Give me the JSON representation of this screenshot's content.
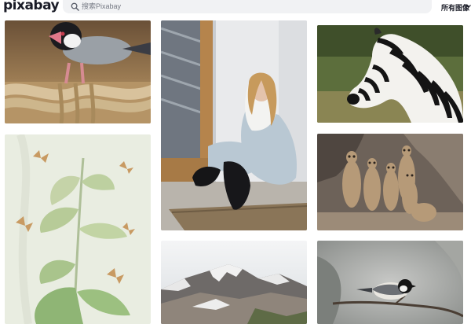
{
  "header": {
    "logo": "pixabay",
    "search_placeholder": "搜索Pixabay",
    "filter_label": "所有图像"
  },
  "icons": {
    "search": "search-icon",
    "filter_chevron": "chevron-down-icon"
  },
  "colors": {
    "header_bg": "#ffffff",
    "search_bg": "#f1f2f4",
    "text": "#191b26",
    "muted": "#767a84"
  },
  "gallery": {
    "columns": 3,
    "images": [
      {
        "subject": "bird-on-rope"
      },
      {
        "subject": "butterflies-and-plant-illustration"
      },
      {
        "subject": "woman-sitting-on-floor"
      },
      {
        "subject": "snowy-mountains"
      },
      {
        "subject": "zebra"
      },
      {
        "subject": "meerkats"
      },
      {
        "subject": "small-bird-on-branch"
      }
    ]
  }
}
